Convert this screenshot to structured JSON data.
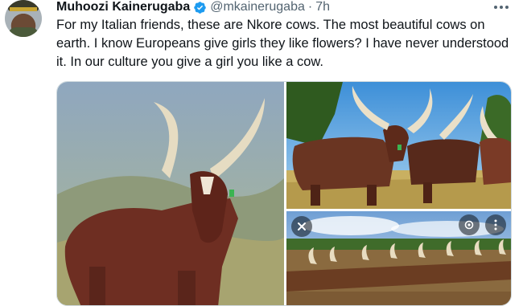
{
  "tweet": {
    "author_name": "Muhoozi Kainerugaba",
    "handle": "@mkainerugaba",
    "separator": "·",
    "time": "7h",
    "text": "For my Italian friends, these are Nkore cows. The most beautiful cows on earth. I know Europeans give girls they like flowers? I have never understood it. In our culture you give a girl you like a cow."
  },
  "icons": {
    "verified": "verified-badge-icon",
    "more": "more-options-icon",
    "lens": "lens-search-icon",
    "overflow": "overflow-dots-icon",
    "close": "close-icon"
  },
  "colors": {
    "verified_blue": "#1d9bf0",
    "text": "#0f1419",
    "secondary": "#536471"
  }
}
